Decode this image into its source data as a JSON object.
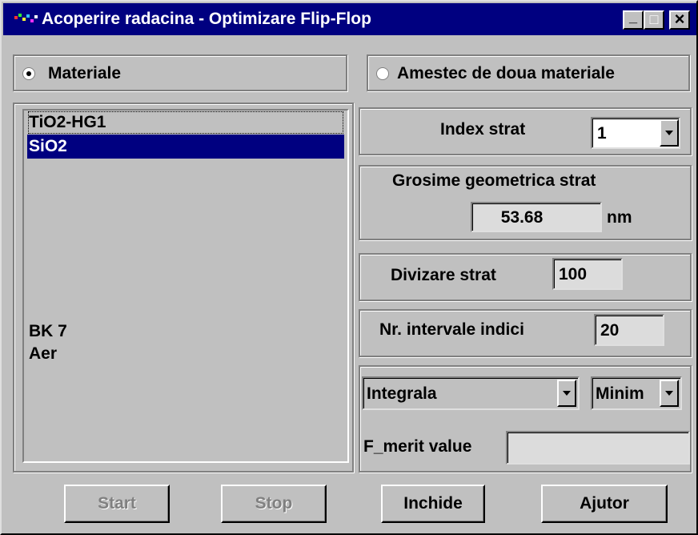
{
  "window": {
    "title": "Acoperire radacina - Optimizare Flip-Flop",
    "controls": {
      "minimize": "_",
      "maximize": "□",
      "close": "×"
    }
  },
  "mode": {
    "option_materials": "Materiale",
    "option_mix": "Amestec de doua materiale",
    "selected": "Materiale"
  },
  "layers_list": {
    "items": [
      "TiO2-HG1",
      "SiO2"
    ],
    "selected": "SiO2",
    "bottom_items": [
      "BK 7",
      "Aer"
    ]
  },
  "layer_index": {
    "label": "Index strat",
    "value": "1"
  },
  "thickness": {
    "label": "Grosime geometrica strat",
    "value": "53.68",
    "unit": "nm"
  },
  "division": {
    "label": "Divizare strat",
    "value": "100"
  },
  "intervals": {
    "label": "Nr. intervale indici",
    "value": "20"
  },
  "merit": {
    "method": "Integrala",
    "goal": "Minim",
    "value_label": "F_merit value",
    "value": ""
  },
  "buttons": {
    "start": "Start",
    "stop": "Stop",
    "close": "Inchide",
    "help": "Ajutor"
  },
  "colors": {
    "titlebar": "#000080",
    "selection": "#000080",
    "face": "#c0c0c0"
  }
}
